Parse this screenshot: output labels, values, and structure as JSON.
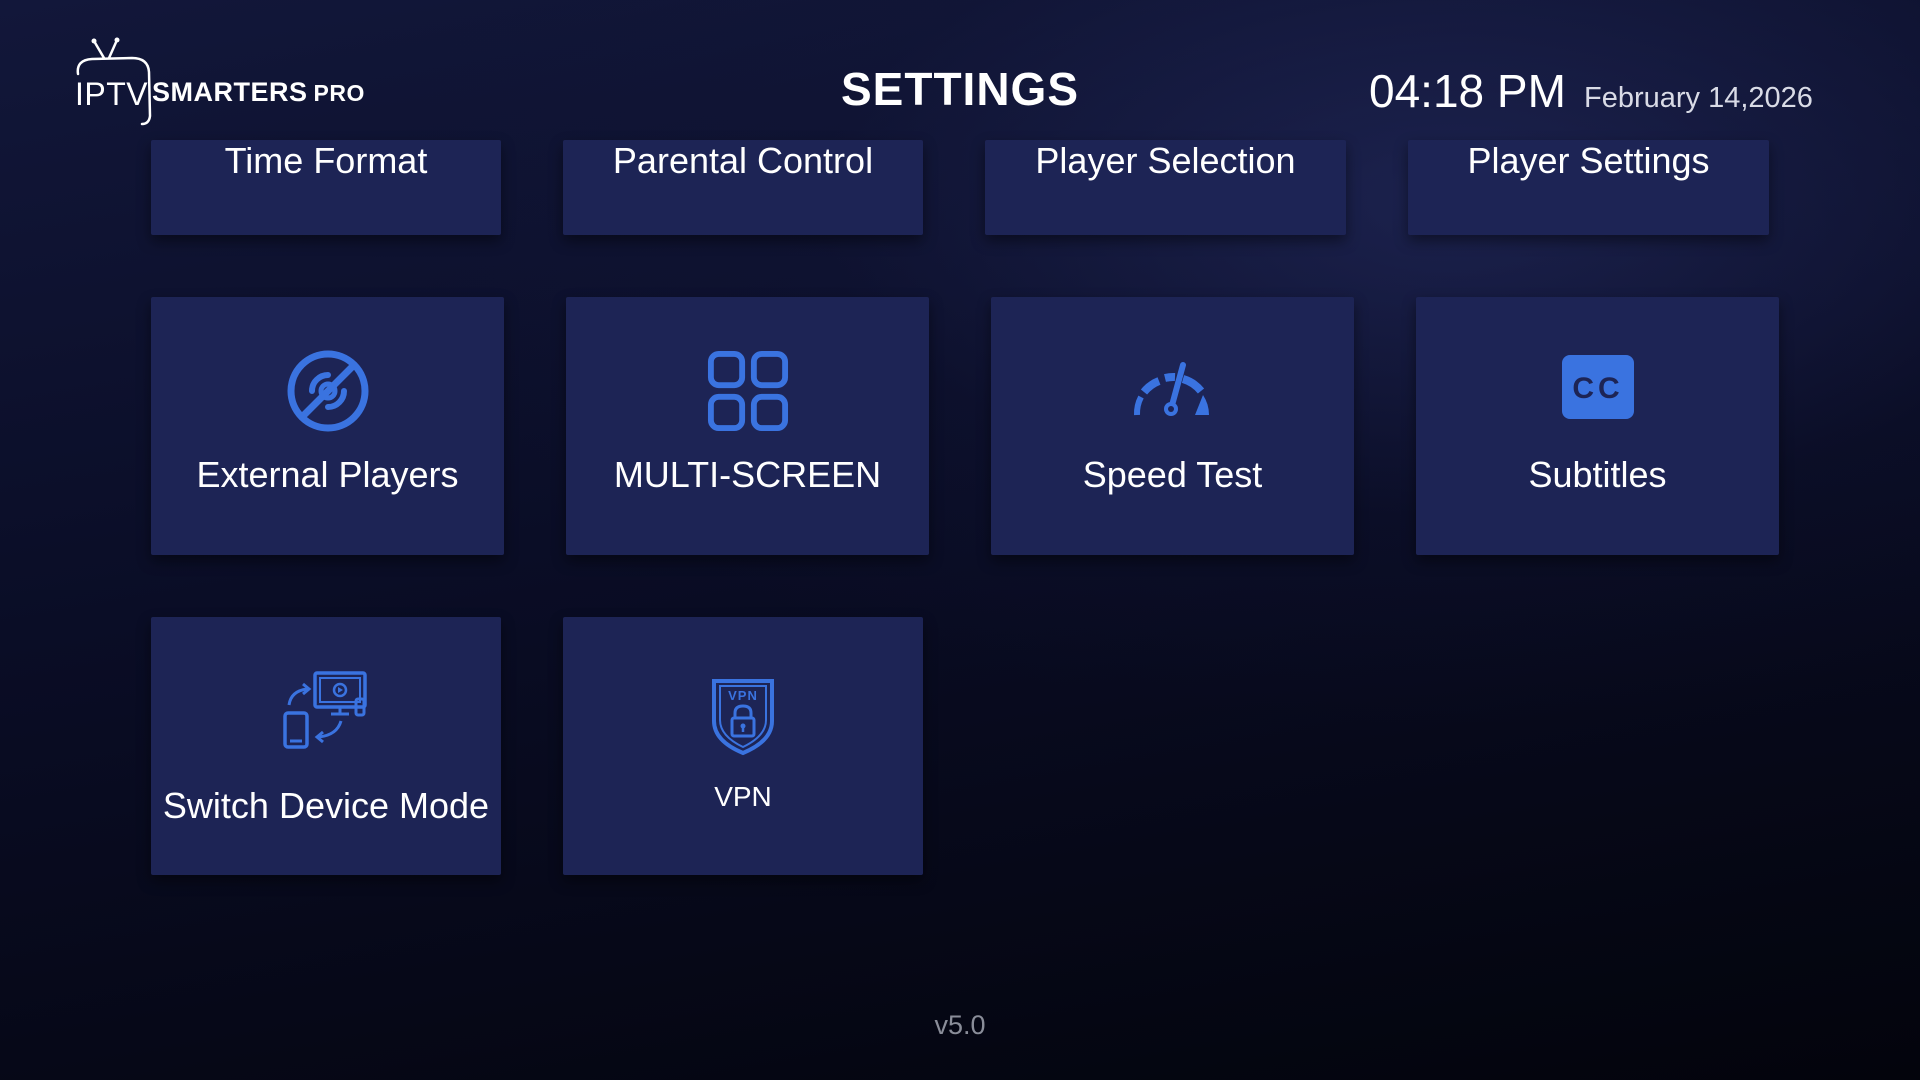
{
  "header": {
    "logo": {
      "prefix": "IPTV",
      "brand": "SMARTERS",
      "suffix": "PRO"
    },
    "title": "SETTINGS",
    "time": "04:18 PM",
    "date": "February 14,2026"
  },
  "tiles": {
    "time_format": {
      "label": "Time Format"
    },
    "parental_control": {
      "label": "Parental Control"
    },
    "player_selection": {
      "label": "Player Selection"
    },
    "player_settings": {
      "label": "Player Settings"
    },
    "external_players": {
      "label": "External Players",
      "icon": "external-players-icon"
    },
    "multi_screen": {
      "label": "MULTI-SCREEN",
      "icon": "multi-screen-grid-icon"
    },
    "speed_test": {
      "label": "Speed Test",
      "icon": "speedometer-icon"
    },
    "subtitles": {
      "label": "Subtitles",
      "icon": "closed-captions-icon",
      "icon_text": "CC"
    },
    "switch_device_mode": {
      "label": "Switch Device Mode",
      "icon": "switch-device-icon"
    },
    "vpn": {
      "label": "VPN",
      "icon": "vpn-shield-icon",
      "icon_text": "VPN"
    }
  },
  "footer": {
    "version": "v5.0"
  },
  "colors": {
    "tile_background": "#1d2455",
    "icon_accent": "#3a73e0",
    "background_dark": "#03040c",
    "version_text": "#8a8d99"
  }
}
